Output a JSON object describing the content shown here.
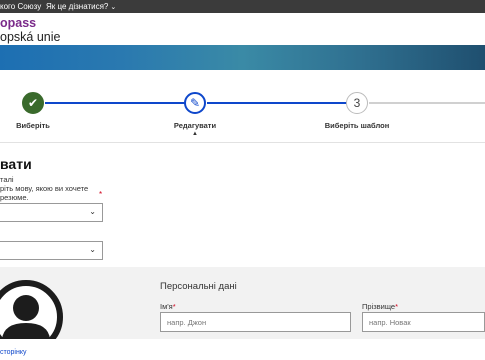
{
  "topbar": {
    "eu_label": "кого Союзу",
    "how_label": "Як це дізнатися?"
  },
  "brand": {
    "name": "opass",
    "subtitle": "opská unie"
  },
  "stepper": {
    "steps": [
      {
        "number": "✔",
        "label": "Виберіть"
      },
      {
        "number": "✎",
        "label": "Редагувати"
      },
      {
        "number": "3",
        "label": "Виберіть шаблон"
      }
    ]
  },
  "form": {
    "title": "вати",
    "details": [
      "талі",
      "ріть мову, якою ви хочете",
      "резюме."
    ],
    "required_mark": "*"
  },
  "personal": {
    "heading": "Персональні дані",
    "first_name_label": "Ім'я",
    "first_name_placeholder": "напр. Джон",
    "last_name_label": "Прізвище",
    "last_name_placeholder": "напр. Новак",
    "required_mark": "*"
  },
  "footer": {
    "history_link": "сторінку"
  },
  "colors": {
    "accent": "#0e47cb",
    "brand": "#7a2a8a",
    "success": "#3a6a2c",
    "required": "#d0021b"
  }
}
